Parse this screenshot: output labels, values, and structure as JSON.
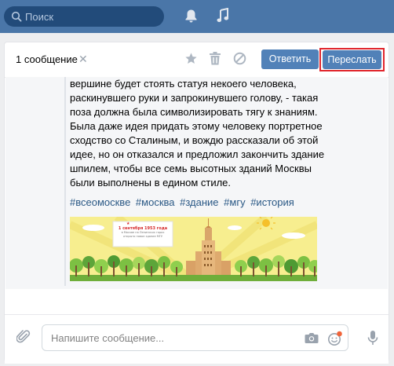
{
  "topbar": {
    "search_placeholder": "Поиск",
    "bg_color": "#4a76a8"
  },
  "header": {
    "count_label": "1 сообщение",
    "reply_label": "Ответить",
    "forward_label": "Переслать",
    "icons": [
      "star-icon",
      "trash-icon",
      "block-icon"
    ]
  },
  "post": {
    "paragraph": "вершине будет стоять статуя некоего человека, раскинувшего руки и запрокинувшего голову, - такая поза должна была символизировать тягу к знаниям. Была даже идея придать этому человеку портретное сходство со Сталиным, и вождю рассказали об этой идее, но он отказался и предложил закончить здание шпилем, чтобы все семь высотных зданий Москвы были выполнены в едином стиле.",
    "tags": [
      "#всеомоскве",
      "#москва",
      "#здание",
      "#мгу",
      "#история"
    ],
    "image_caption_date": "1 сентября 1953 года",
    "image_caption_sub": "в Москве на Ленинских горах открыто новое здание МГУ"
  },
  "composer": {
    "placeholder": "Напишите сообщение..."
  },
  "colors": {
    "accent": "#5181b8",
    "link": "#2a5885",
    "highlight_border": "#e1262d"
  }
}
